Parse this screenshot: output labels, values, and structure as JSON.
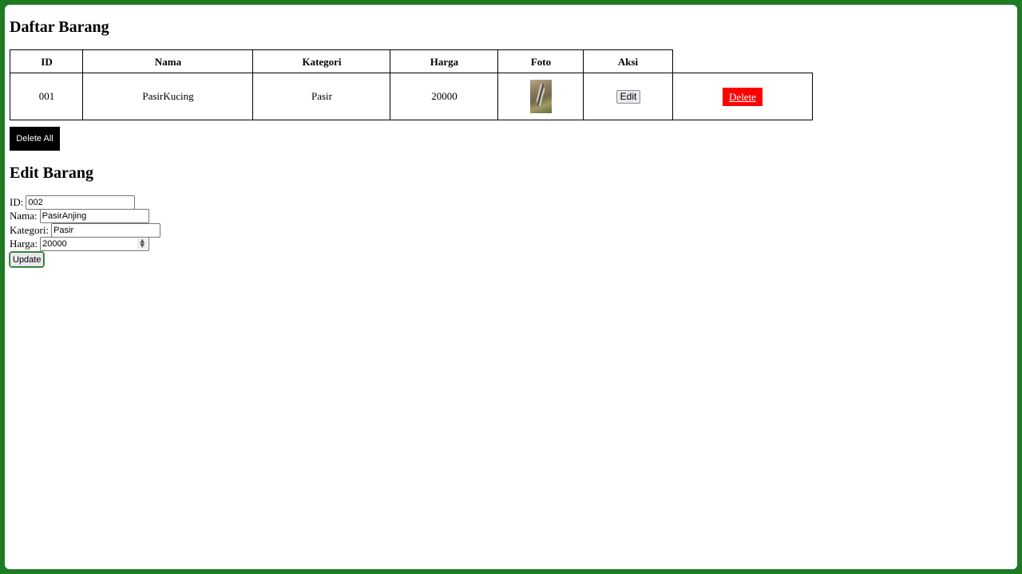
{
  "list": {
    "title": "Daftar Barang",
    "headers": [
      "ID",
      "Nama",
      "Kategori",
      "Harga",
      "Foto",
      "Aksi"
    ],
    "rows": [
      {
        "id": "001",
        "nama": "PasirKucing",
        "kategori": "Pasir",
        "harga": "20000",
        "foto": "product-photo",
        "edit_label": "Edit",
        "delete_label": "Delete"
      }
    ],
    "delete_all_label": "Delete All"
  },
  "edit": {
    "title": "Edit Barang",
    "id_label": "ID:",
    "id_value": "002",
    "nama_label": "Nama:",
    "nama_value": "PasirAnjing",
    "kategori_label": "Kategori:",
    "kategori_value": "Pasir",
    "harga_label": "Harga:",
    "harga_value": "20000",
    "update_label": "Update"
  },
  "colors": {
    "frame": "#1e7a23",
    "delete": "#ff0000",
    "delete_all": "#000000"
  }
}
